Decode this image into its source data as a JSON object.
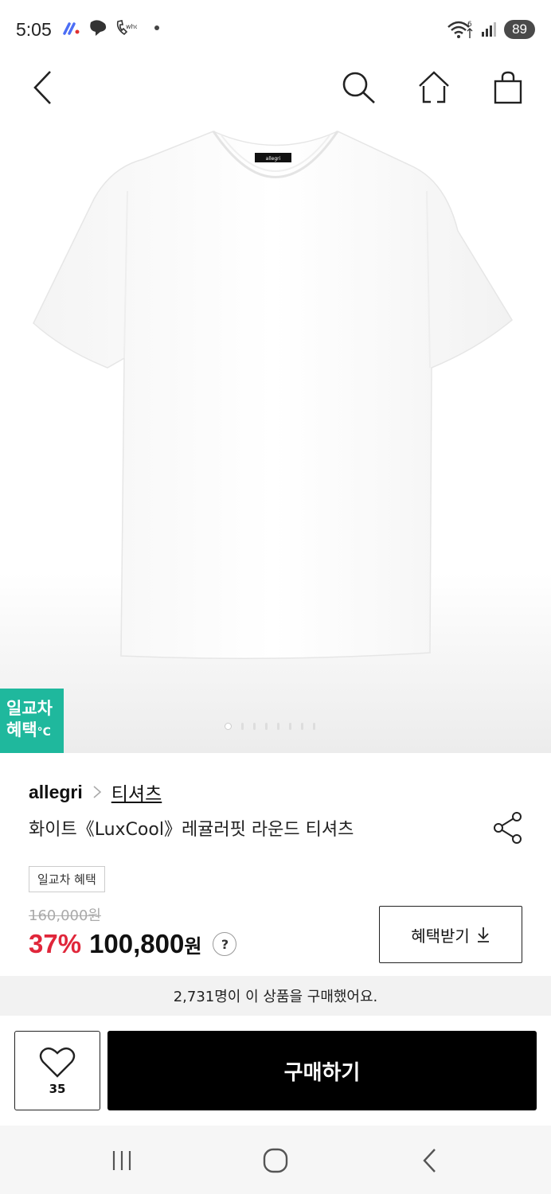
{
  "status_bar": {
    "time": "5:05",
    "wifi_label": "6",
    "battery": "89"
  },
  "nav": {
    "back_icon": "chevron-left-icon",
    "search_icon": "search-icon",
    "home_icon": "home-icon",
    "cart_icon": "shopping-bag-icon"
  },
  "image": {
    "promo_badge_line1": "일교차",
    "promo_badge_line2": "혜택",
    "promo_badge_suffix": "°C",
    "page_count": 8,
    "active_page": 1
  },
  "product": {
    "brand": "allegri",
    "category": "티셔츠",
    "title": "화이트《LuxCool》레귤러핏 라운드 티셔츠",
    "benefit_tag": "일교차 혜택",
    "original_price": "160,000원",
    "discount": "37%",
    "sale_price": "100,800",
    "sale_price_unit": "원",
    "help_label": "?",
    "coupon_label": "혜택받기",
    "buyers_text": "2,731명이 이 상품을 구매했어요."
  },
  "actions": {
    "like_count": "35",
    "buy_label": "구매하기"
  },
  "colors": {
    "discount": "#e0263a",
    "promo_badge": "#1fb89d",
    "buy_button": "#000000"
  }
}
